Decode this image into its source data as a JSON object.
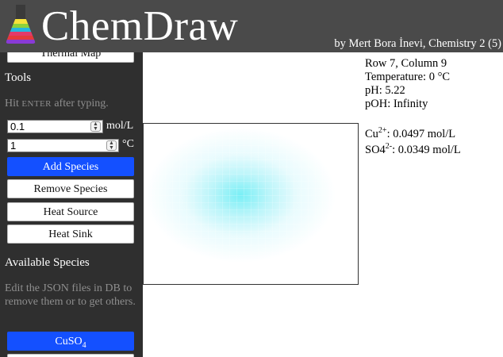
{
  "header": {
    "title": "ChemDraw",
    "byline": "by Mert Bora İnevi, Chemistry 2 (5)"
  },
  "sidebar": {
    "top_button": "Thermal Map",
    "tools_title": "Tools",
    "hint_prefix": "Hit",
    "hint_key": "ENTER",
    "hint_suffix": "after typing.",
    "concentration_value": "0.1",
    "concentration_unit": "mol/L",
    "temperature_value": "1",
    "temperature_unit": "°C",
    "buttons": {
      "add": "Add Species",
      "remove": "Remove Species",
      "heat_source": "Heat Source",
      "heat_sink": "Heat Sink"
    },
    "species_title": "Available Species",
    "species_hint": "Edit the JSON files in DB to remove them or to get others.",
    "species": [
      {
        "main": "CuSO",
        "sub": "4"
      }
    ]
  },
  "cell_info": {
    "position": "Row 7, Column 9",
    "temperature": "Temperature: 0 °C",
    "ph": "pH: 5.22",
    "poh": "pOH: Infinity"
  },
  "ions": [
    {
      "name": "Cu",
      "charge": "2+",
      "value": ": 0.0497 mol/L"
    },
    {
      "name": "SO4",
      "charge": "2-",
      "value": ": 0.0349 mol/L"
    }
  ],
  "colors": {
    "header_bg": "#4a4a4a",
    "sidebar_bg": "#2f2f2f",
    "accent": "#1450ff",
    "concentration_tint": "#60ecf4"
  },
  "icons": {
    "logo": "rainbow-flask-icon",
    "spinner": "stepper-arrows-icon"
  }
}
